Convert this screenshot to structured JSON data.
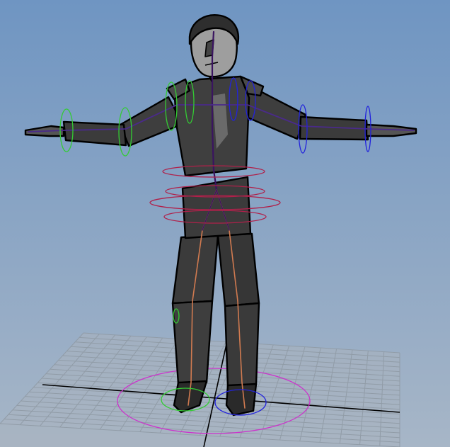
{
  "viewport": {
    "background_top": "#6f95c2",
    "background_bottom": "#a7b6c7",
    "grid_color": "#8f9aa5",
    "grid_fill": "#a9b3bd",
    "axis_color": "#000000"
  },
  "character": {
    "body_color": "#3b3b3b",
    "body_highlight": "#6a6a6a",
    "head_color": "#9e9e9e",
    "outline_color": "#000000"
  },
  "rig": {
    "spine_joint_color": "#3a1460",
    "arm_joint_color": "#4a2a8a",
    "leg_joint_color": "#d07a50",
    "left_control_color": "#33cc33",
    "right_control_color": "#2222dd",
    "hip_control_color": "#b0204a",
    "root_control_color": "#cc33cc"
  }
}
